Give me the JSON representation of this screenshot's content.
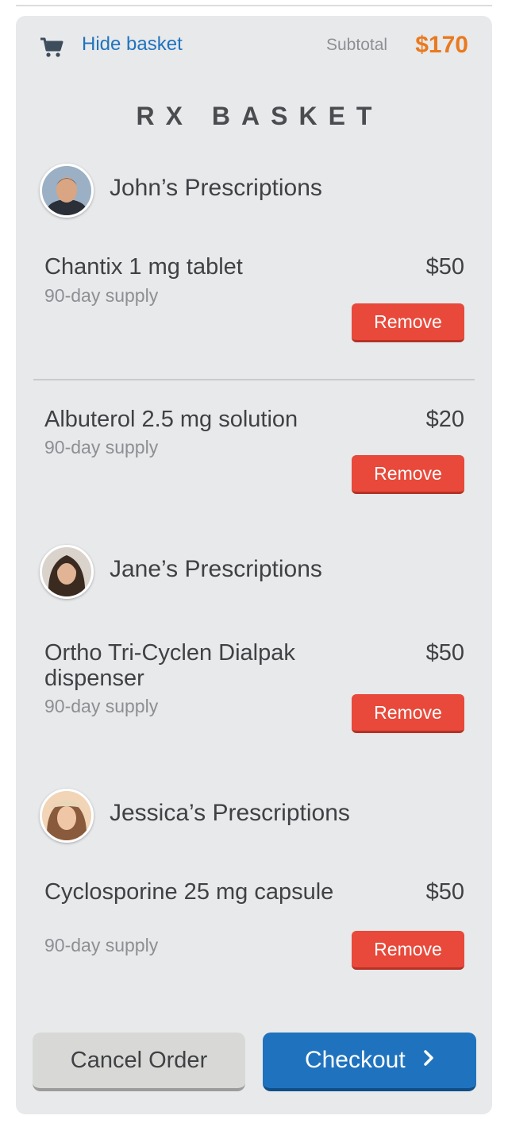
{
  "header": {
    "hide_label": "Hide basket",
    "subtotal_label": "Subtotal",
    "subtotal_value": "$170",
    "cart_icon": "cart-icon"
  },
  "title": "RX BASKET",
  "people": [
    {
      "name": "John’s Prescriptions",
      "items": [
        {
          "name": "Chantix 1 mg tablet",
          "price": "$50",
          "supply": "90-day supply",
          "remove_label": "Remove"
        },
        {
          "name": "Albuterol 2.5 mg solution",
          "price": "$20",
          "supply": "90-day supply",
          "remove_label": "Remove"
        }
      ]
    },
    {
      "name": "Jane’s Prescriptions",
      "items": [
        {
          "name": "Ortho Tri-Cyclen Dialpak dispenser",
          "price": "$50",
          "supply": "90-day supply",
          "remove_label": "Remove"
        }
      ]
    },
    {
      "name": "Jessica’s Prescriptions",
      "items": [
        {
          "name": "Cyclosporine 25 mg capsule",
          "price": "$50",
          "supply": "90-day supply",
          "remove_label": "Remove"
        }
      ]
    }
  ],
  "footer": {
    "cancel_label": "Cancel Order",
    "checkout_label": "Checkout"
  },
  "colors": {
    "accent_blue": "#1f73be",
    "subtotal_orange": "#e97a1f",
    "remove_red": "#e8493a",
    "panel_bg": "#e8e9eb"
  }
}
